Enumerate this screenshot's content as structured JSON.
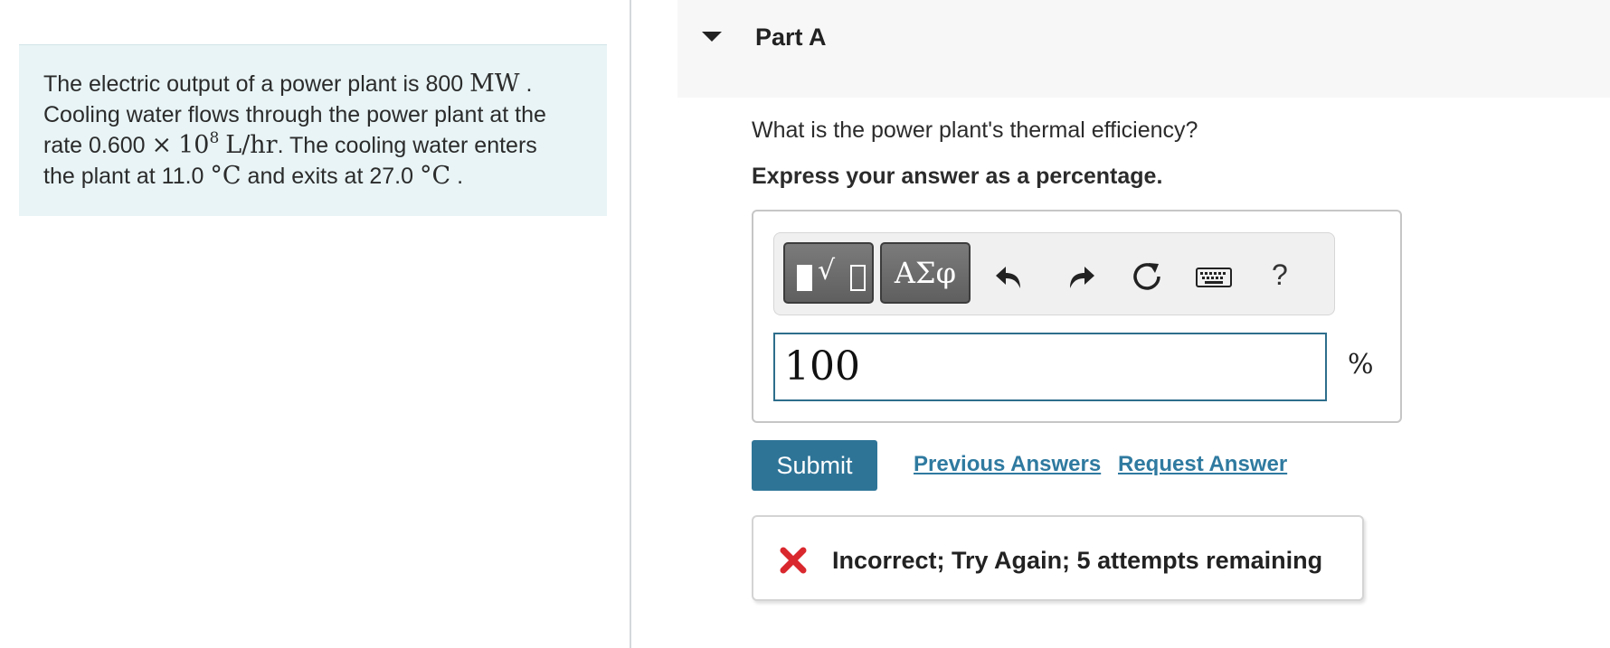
{
  "problem": {
    "line1_prefix": "The electric output of a power plant is 800",
    "line1_unit": "MW",
    "line1_suffix": ".",
    "line2": "Cooling water flows through the power plant at the",
    "line3_prefix": "rate 0.600",
    "line3_times": "×",
    "line3_base": "10",
    "line3_exp": "8",
    "line3_unit": "L/hr",
    "line3_suffix": ". The cooling water enters",
    "line4_prefix": "the plant at 11.0",
    "line4_unit1": "°C",
    "line4_middle": "and exits at 27.0",
    "line4_unit2": "°C",
    "line4_suffix": "."
  },
  "part": {
    "title": "Part A"
  },
  "question": "What is the power plant's thermal efficiency?",
  "instruction": "Express your answer as a percentage.",
  "toolbar": {
    "greek_label": "ΑΣφ",
    "help_label": "?",
    "icons": [
      "templates-icon",
      "greek-letters-icon",
      "undo-icon",
      "redo-icon",
      "reset-icon",
      "keyboard-icon",
      "help-icon"
    ]
  },
  "answer": {
    "value": "100",
    "unit": "%"
  },
  "actions": {
    "submit_label": "Submit",
    "previous_answers_label": "Previous Answers",
    "request_answer_label": "Request Answer"
  },
  "feedback": {
    "message": "Incorrect; Try Again; 5 attempts remaining",
    "status_color": "#d9282e"
  },
  "colors": {
    "accent": "#2e7497",
    "link": "#2f7aa0",
    "problem_bg": "#e8f4f6",
    "input_border": "#2e6e8c"
  }
}
